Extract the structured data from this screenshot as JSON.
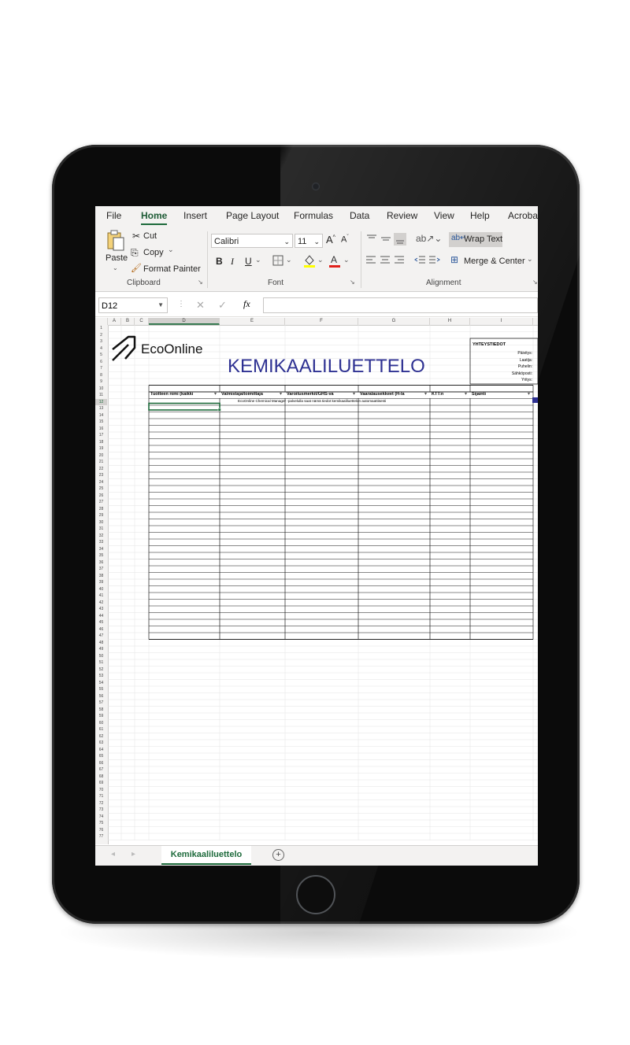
{
  "menu": [
    "File",
    "Home",
    "Insert",
    "Page Layout",
    "Formulas",
    "Data",
    "Review",
    "View",
    "Help",
    "Acrobat"
  ],
  "ribbon": {
    "paste": "Paste",
    "cut": "Cut",
    "copy": "Copy",
    "format_painter": "Format Painter",
    "clipboard_label": "Clipboard",
    "font_name": "Calibri",
    "font_size": "11",
    "grow_font": "A^",
    "shrink_font": "A˅",
    "bold": "B",
    "italic": "I",
    "underline": "U",
    "font_label": "Font",
    "wrap_text": "Wrap Text",
    "merge_center": "Merge & Center",
    "alignment_label": "Alignment"
  },
  "formula_bar": {
    "cell_ref": "D12",
    "fx": "fx",
    "value": ""
  },
  "sheet": {
    "logo_text": "EcoOnline",
    "title": "KEMIKAALILUETTELO",
    "info_title": "YHTEYSTIEDOT",
    "info_labels": [
      "Päivitys:",
      "Laatija:",
      "Puhelin:",
      "Sähköposti:",
      "Yritys:"
    ],
    "headers": [
      "Tuotteen nimi (kaikki",
      "Valmistaja/toimittaja",
      "Varoitusmerkit/GHS-va",
      "Vaaralausekkeet (H-la",
      "KTT:n",
      "Sijainti"
    ],
    "note": "EcoOnline Chemical Manager -palvelulla saat nämä tiedot kemikaaliluettelon automaattisesti",
    "columns": [
      "A",
      "B",
      "C",
      "D",
      "E",
      "F",
      "G",
      "H",
      "I"
    ],
    "row_count": 77
  },
  "tabs": {
    "sheet_name": "Kemikaaliluettelo",
    "add": "+"
  },
  "colors": {
    "excel_green": "#1d6a3b",
    "title_blue": "#2e3192",
    "frame": "#0b0b0b"
  }
}
